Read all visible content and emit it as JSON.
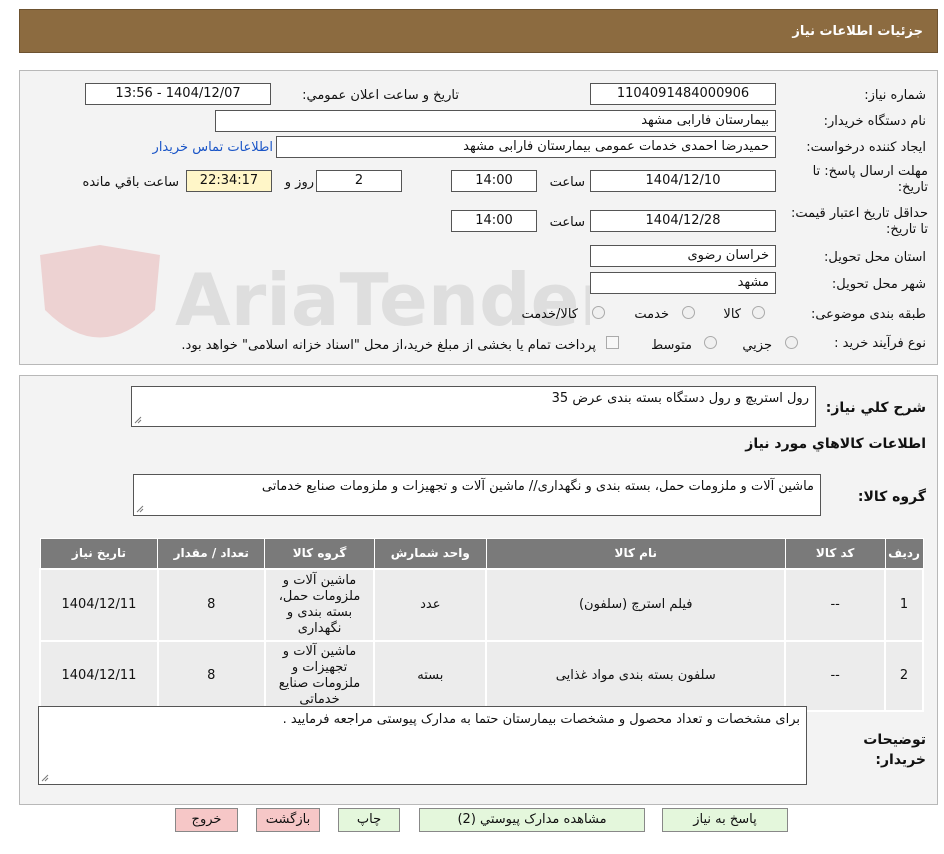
{
  "header": {
    "title": "جزئیات اطلاعات نیاز"
  },
  "watermark": {
    "text": "AriaTender.net"
  },
  "form": {
    "need_number_label": "شماره نیاز:",
    "need_number": "1104091484000906",
    "announce_label": "تاریخ و ساعت اعلان عمومي:",
    "announce_value": "1404/12/07 - 13:56",
    "buyer_org_label": "نام دستگاه خریدار:",
    "buyer_org": "بیمارستان فارابی مشهد",
    "requester_label": "ایجاد کننده درخواست:",
    "requester": "حمیدرضا احمدی خدمات عمومی بیمارستان فارابی مشهد",
    "contact_link": "اطلاعات تماس خریدار",
    "deadline_label": "مهلت ارسال پاسخ: تا تاریخ:",
    "deadline_date": "1404/12/10",
    "time_label": "ساعت",
    "deadline_time": "14:00",
    "days_value": "2",
    "days_label": "روز و",
    "remaining_time": "22:34:17",
    "remaining_label": "ساعت باقي مانده",
    "validity_label": "حداقل تاریخ اعتبار قیمت: تا تاریخ:",
    "validity_date": "1404/12/28",
    "validity_time": "14:00",
    "province_label": "استان محل تحویل:",
    "province": "خراسان رضوی",
    "city_label": "شهر محل تحویل:",
    "city": "مشهد",
    "category_label": "طبقه بندی موضوعی:",
    "category_options": [
      "کالا",
      "خدمت",
      "کالا/خدمت"
    ],
    "process_label": "نوع فرآیند خرید :",
    "process_options": [
      "جزیي",
      "متوسط"
    ],
    "payment_note": "پرداخت تمام یا بخشی از مبلغ خرید،از محل \"اسناد خزانه اسلامی\" خواهد بود."
  },
  "summary": {
    "general_label": "شرح کلي نیاز:",
    "general_value": "رول استریچ و رول دستگاه بسته بندی عرض 35",
    "goods_info_title": "اطلاعات کالاهاي مورد نیاز",
    "goods_group_label": "گروه کالا:",
    "goods_group_value": "ماشین آلات و ملزومات حمل، بسته بندی و نگهداری// ماشین آلات و تجهیزات و ملزومات صنایع خدماتی"
  },
  "table": {
    "headers": [
      "ردیف",
      "کد کالا",
      "نام کالا",
      "واحد شمارش",
      "گروه کالا",
      "تعداد / مقدار",
      "تاریخ نیاز"
    ],
    "rows": [
      [
        "1",
        "--",
        "فیلم استرچ (سلفون)",
        "عدد",
        "ماشین آلات و ملزومات حمل، بسته بندی و نگهداری",
        "8",
        "1404/12/11"
      ],
      [
        "2",
        "--",
        "سلفون بسته بندی مواد غذایی",
        "بسته",
        "ماشین آلات و تجهیزات و ملزومات صنایع خدماتی",
        "8",
        "1404/12/11"
      ]
    ]
  },
  "notes": {
    "label": "توضیحات خریدار:",
    "value": "برای مشخصات و تعداد محصول و مشخصات بیمارستان حتما به مدارک پیوستی مراجعه فرمایید ."
  },
  "buttons": {
    "reply": "پاسخ به نیاز",
    "attachments": "مشاهده مدارک پیوستي (2)",
    "print": "چاپ",
    "back": "بازگشت",
    "exit": "خروج"
  },
  "colors": {
    "header_bg": "#8c6b40",
    "button_green": "#e4f7dc",
    "button_red": "#f6c7c7",
    "table_header": "#7a7a7a",
    "link": "#1a55c7"
  }
}
